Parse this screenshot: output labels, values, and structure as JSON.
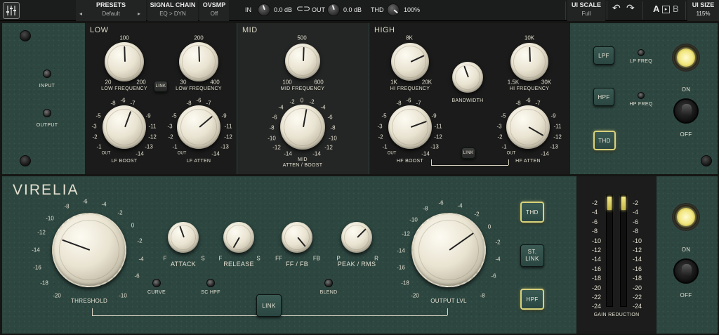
{
  "topbar": {
    "presets": {
      "label": "PRESETS",
      "value": "Default"
    },
    "signal_chain": {
      "label": "SIGNAL CHAIN",
      "value": "EQ > DYN"
    },
    "ovsmp": {
      "label": "OVSMP",
      "value": "Off"
    },
    "in": {
      "label": "IN",
      "value": "0.0 dB"
    },
    "out": {
      "label": "OUT",
      "value": "0.0 dB"
    },
    "thd": {
      "label": "THD",
      "value": "100%"
    },
    "ui_scale": {
      "label": "UI SCALE",
      "value": "Full"
    },
    "ab": {
      "a": "A",
      "b": "B"
    },
    "ui_size": {
      "label": "UI SIZE",
      "value": "115%"
    }
  },
  "eq": {
    "left": {
      "input": "INPUT",
      "output": "OUTPUT"
    },
    "low": {
      "title": "LOW",
      "link": "LINK",
      "freq1": {
        "label": "LOW FREQUENCY",
        "ticks": [
          "100",
          "20",
          "200"
        ]
      },
      "freq2": {
        "label": "LOW FREQUENCY",
        "ticks": [
          "200",
          "30",
          "400"
        ]
      },
      "boost": {
        "label": "LF BOOST",
        "ticks": [
          "-6",
          "-7",
          "-8",
          "-5",
          "-9",
          "-4",
          "-10",
          "-3",
          "-11",
          "-2",
          "-12",
          "-1",
          "-13",
          "OUT",
          "-14"
        ]
      },
      "atten": {
        "label": "LF ATTEN",
        "ticks": [
          "-6",
          "-7",
          "-8",
          "-5",
          "-9",
          "-4",
          "-10",
          "-3",
          "-11",
          "-2",
          "-12",
          "-1",
          "-13",
          "OUT",
          "-14"
        ]
      }
    },
    "mid": {
      "title": "MID",
      "freq": {
        "label": "MID FREQUENCY",
        "ticks": [
          "500",
          "100",
          "600"
        ]
      },
      "gain": {
        "label": "MID\nATTEN / BOOST",
        "ticks": [
          "-2",
          "0",
          "-2",
          "-4",
          "-4",
          "-6",
          "-6",
          "-8",
          "-8",
          "-10",
          "-10",
          "-12",
          "-12",
          "-14",
          "-14"
        ]
      }
    },
    "high": {
      "title": "HIGH",
      "link": "LINK",
      "freq1": {
        "label": "HI FREQUENCY",
        "ticks": [
          "8K",
          "1K",
          "20K"
        ]
      },
      "bandwidth": {
        "label": "BANDWIDTH"
      },
      "freq2": {
        "label": "HI FREQUENCY",
        "ticks": [
          "10K",
          "1.5K",
          "30K"
        ]
      },
      "boost": {
        "label": "HF BOOST",
        "ticks": [
          "-6",
          "-7",
          "-8",
          "-5",
          "-9",
          "-4",
          "-10",
          "-3",
          "-11",
          "-2",
          "-12",
          "-1",
          "-13",
          "OUT",
          "-14"
        ]
      },
      "atten": {
        "label": "HF ATTEN",
        "ticks": [
          "-6",
          "-7",
          "-8",
          "-5",
          "-9",
          "-4",
          "-10",
          "-3",
          "-11",
          "-2",
          "-12",
          "-1",
          "-13",
          "OUT",
          "-14"
        ]
      }
    },
    "right": {
      "lpf": "LPF",
      "lp_freq": "LP FREQ",
      "hpf": "HPF",
      "hp_freq": "HP FREQ",
      "thd": "THD",
      "on": "ON",
      "off": "OFF"
    }
  },
  "comp": {
    "brand": "VIRELIA",
    "threshold": {
      "label": "THRESHOLD",
      "ticks": [
        "-8",
        "-6",
        "-4",
        "-10",
        "-2",
        "-12",
        "0",
        "-14",
        "-2",
        "-16",
        "-4",
        "-18",
        "-6",
        "-20",
        "-10"
      ]
    },
    "attack": {
      "label": "ATTACK",
      "f": "F",
      "s": "S"
    },
    "release": {
      "label": "RELEASE",
      "f": "F",
      "s": "S"
    },
    "fffb": {
      "label": "FF / FB",
      "ff": "FF",
      "fb": "FB"
    },
    "peakrms": {
      "label": "PEAK / RMS",
      "p": "P",
      "r": "R"
    },
    "curve": "CURVE",
    "sc_hpf": "SC HPF",
    "blend": "BLEND",
    "link": "LINK",
    "output": {
      "label": "OUTPUT LVL",
      "ticks": [
        "-6",
        "-4",
        "-8",
        "-2",
        "-10",
        "0",
        "-12",
        "-2",
        "-14",
        "-4",
        "-16",
        "-6",
        "-18",
        "-20",
        "-8"
      ]
    },
    "thd": "THD",
    "st_link": "ST.\nLINK",
    "hpf": "HPF",
    "on": "ON",
    "off": "OFF"
  },
  "meter": {
    "label": "GAIN REDUCTION",
    "scale": [
      "-2",
      "-4",
      "-6",
      "-8",
      "-10",
      "-12",
      "-14",
      "-16",
      "-18",
      "-20",
      "-22",
      "-24"
    ],
    "left_level": 0.12,
    "right_level": 0.12
  },
  "colors": {
    "panel": "#2d4640",
    "cream": "#ece6d4",
    "lamp": "#f1e67c"
  }
}
